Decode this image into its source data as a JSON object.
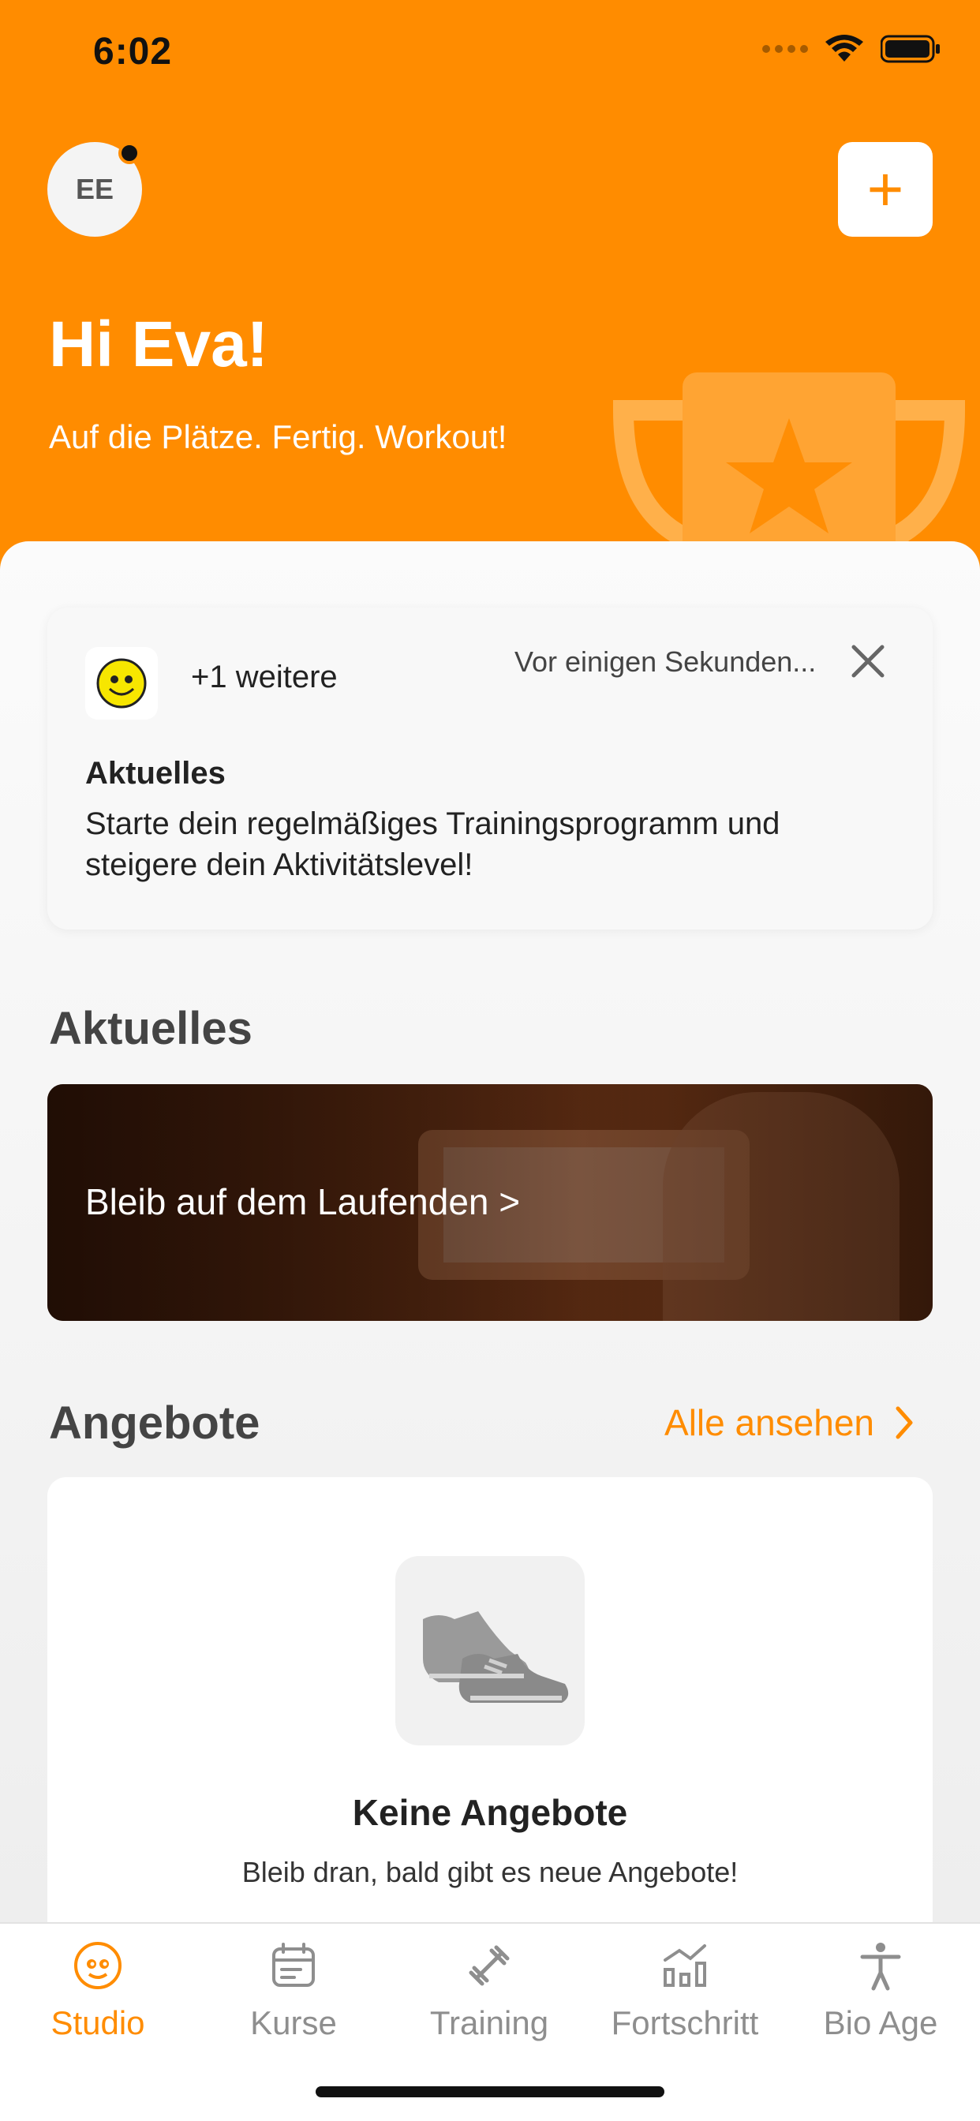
{
  "status_bar": {
    "time": "6:02"
  },
  "header": {
    "avatar_initials": "EE",
    "add_label": "+",
    "greeting": "Hi Eva!",
    "tagline": "Auf die Plätze. Fertig. Workout!"
  },
  "notification": {
    "more": "+1 weitere",
    "time": "Vor einigen Sekunden...",
    "title": "Aktuelles",
    "body": "Starte dein regelmäßiges Trainingsprogramm und steigere dein Aktivitätslevel!"
  },
  "news": {
    "section_title": "Aktuelles",
    "banner_text": "Bleib auf dem Laufenden >"
  },
  "offers": {
    "section_title": "Angebote",
    "see_all": "Alle ansehen",
    "empty_title": "Keine Angebote",
    "empty_subtitle": "Bleib dran, bald gibt es neue Angebote!"
  },
  "tabs": [
    {
      "label": "Studio",
      "icon": "smiley-icon",
      "active": true
    },
    {
      "label": "Kurse",
      "icon": "calendar-icon",
      "active": false
    },
    {
      "label": "Training",
      "icon": "dumbbell-icon",
      "active": false
    },
    {
      "label": "Fortschritt",
      "icon": "chart-icon",
      "active": false
    },
    {
      "label": "Bio Age",
      "icon": "person-icon",
      "active": false
    }
  ],
  "colors": {
    "accent": "#ff8c00",
    "inactive": "#8e8e8e"
  }
}
